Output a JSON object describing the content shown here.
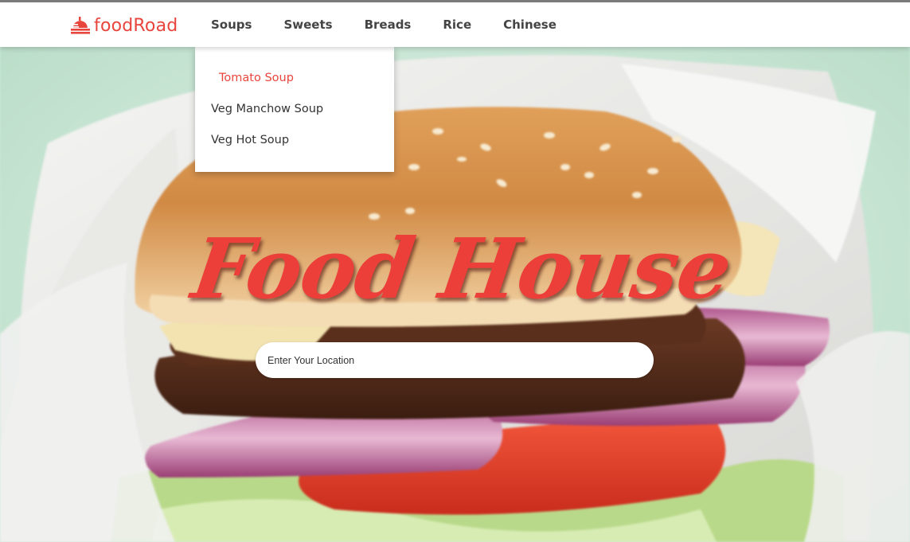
{
  "brand": {
    "name": "foodRoad",
    "icon": "cloche-icon",
    "color": "#e8453c"
  },
  "nav": {
    "items": [
      {
        "label": "Soups"
      },
      {
        "label": "Sweets"
      },
      {
        "label": "Breads"
      },
      {
        "label": "Rice"
      },
      {
        "label": "Chinese"
      }
    ]
  },
  "dropdown": {
    "parent": "Soups",
    "items": [
      {
        "label": "Tomato Soup",
        "active": true
      },
      {
        "label": "Veg Manchow Soup",
        "active": false
      },
      {
        "label": "Veg Hot Soup",
        "active": false
      }
    ]
  },
  "hero": {
    "title": "Food House",
    "title_color": "#ec3f3a",
    "background": "burger-photo"
  },
  "search": {
    "placeholder": "Enter Your Location",
    "value": ""
  }
}
